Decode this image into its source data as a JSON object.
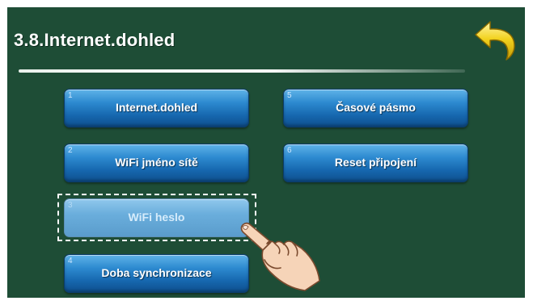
{
  "screen": {
    "title": "3.8.Internet.dohled"
  },
  "menu": {
    "buttons": [
      {
        "number": "1",
        "label": "Internet.dohled",
        "state": "enabled"
      },
      {
        "number": "2",
        "label": "WiFi jméno sítě",
        "state": "enabled"
      },
      {
        "number": "3",
        "label": "WiFi heslo",
        "state": "disabled"
      },
      {
        "number": "4",
        "label": "Doba synchronizace",
        "state": "enabled"
      },
      {
        "number": "5",
        "label": "Časové pásmo",
        "state": "enabled"
      },
      {
        "number": "6",
        "label": "Reset připojení",
        "state": "enabled"
      }
    ]
  },
  "icons": {
    "back": "back-arrow-icon",
    "pointer": "pointing-hand-icon"
  },
  "colors": {
    "background": "#1e4d36",
    "button": "#1667ae",
    "button_disabled": "#6aaedc",
    "back_arrow": "#f2d21e"
  }
}
